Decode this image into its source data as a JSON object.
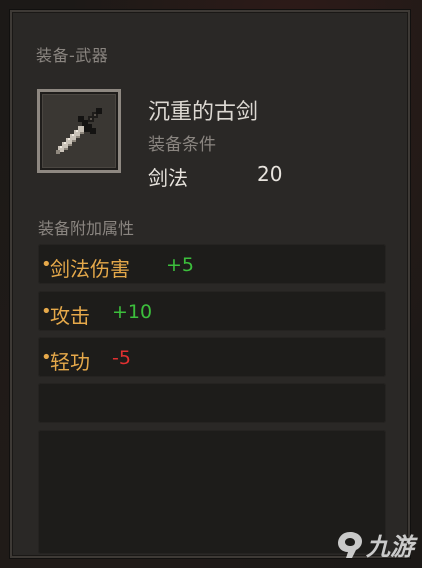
{
  "category": "装备-武器",
  "item": {
    "name": "沉重的古剑",
    "icon": "sword-icon"
  },
  "requirement": {
    "label": "装备条件",
    "skill": "剑法",
    "value": "20"
  },
  "attributes": {
    "title": "装备附加属性",
    "rows": [
      {
        "bullet": "•",
        "label": "剑法伤害",
        "value": "+5",
        "sign": "positive"
      },
      {
        "bullet": "•",
        "label": "攻击",
        "value": "+10",
        "sign": "positive"
      },
      {
        "bullet": "•",
        "label": "轻功",
        "value": "-5",
        "sign": "negative"
      }
    ]
  },
  "watermark": {
    "text": "九游",
    "icon": "jiuyou-logo-icon"
  },
  "colors": {
    "label": "#e6a94a",
    "positive": "#3cbf3c",
    "negative": "#e03030",
    "muted": "#8a8580"
  }
}
